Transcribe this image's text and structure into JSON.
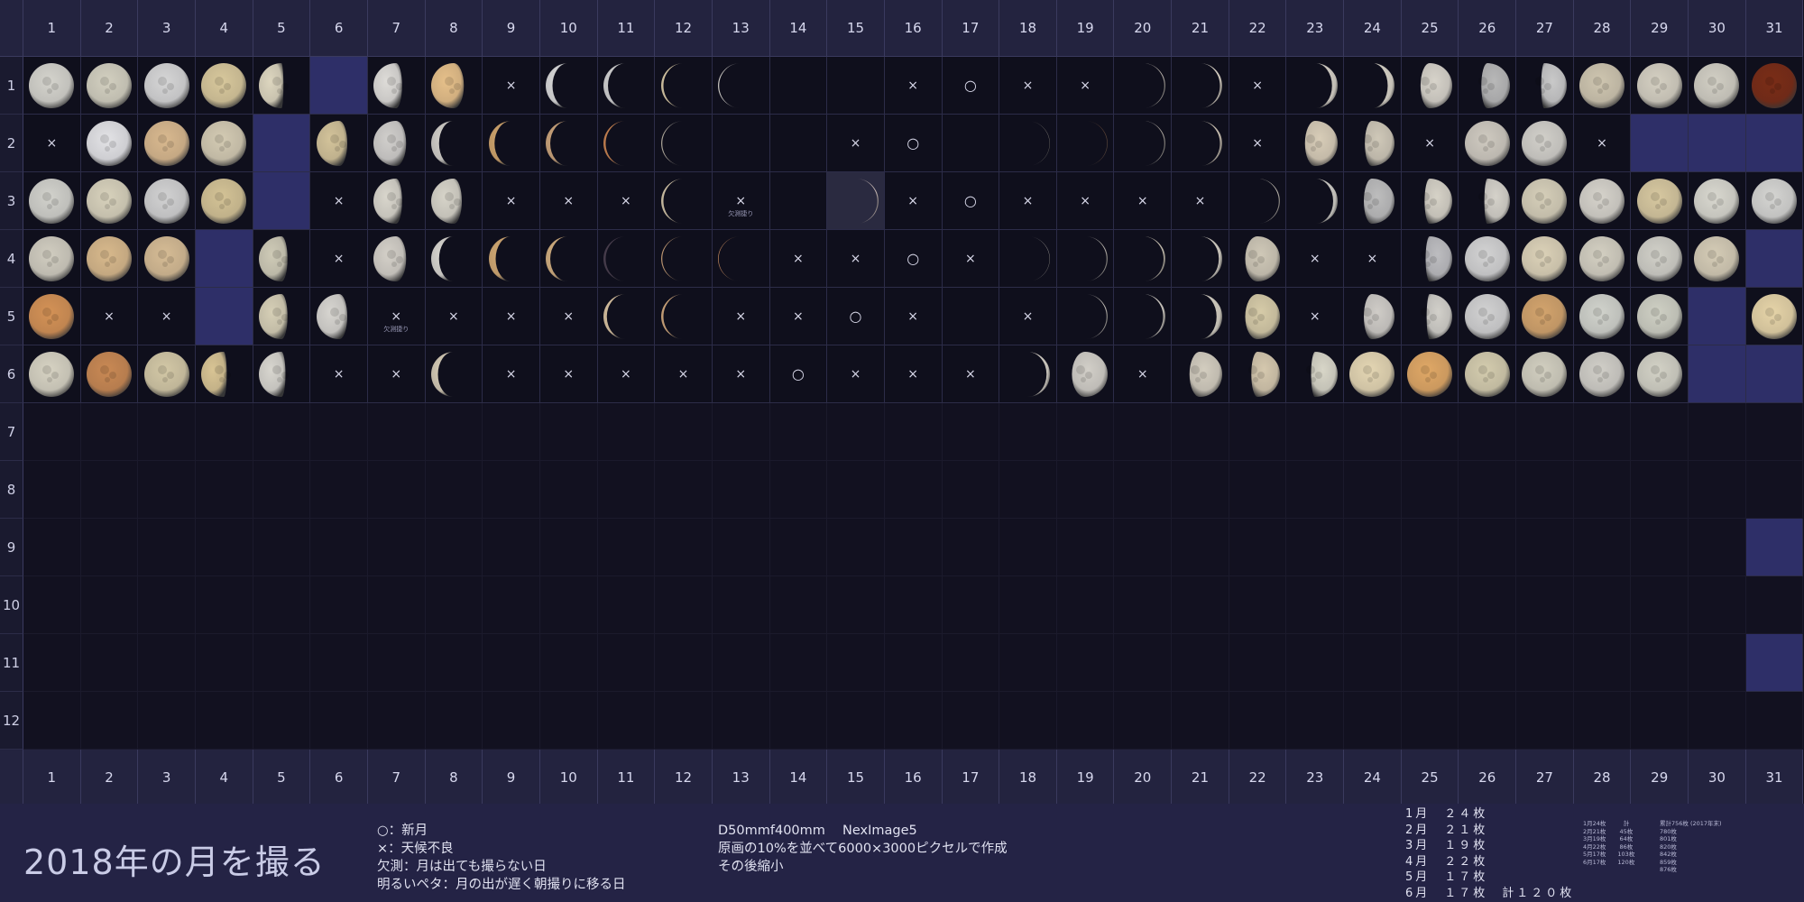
{
  "title": "2018年の月を撮る",
  "days": [
    "1",
    "2",
    "3",
    "4",
    "5",
    "6",
    "7",
    "8",
    "9",
    "10",
    "11",
    "12",
    "13",
    "14",
    "15",
    "16",
    "17",
    "18",
    "19",
    "20",
    "21",
    "22",
    "23",
    "24",
    "25",
    "26",
    "27",
    "28",
    "29",
    "30",
    "31"
  ],
  "months": [
    "1",
    "2",
    "3",
    "4",
    "5",
    "6",
    "7",
    "8",
    "9",
    "10",
    "11",
    "12"
  ],
  "legend": [
    "○：新月",
    "×：天候不良",
    "欠測：月は出ても撮らない日",
    "明るいペタ：月の出が遅く朝撮りに移る日"
  ],
  "tech": [
    "D50mmf400mm　 NexImage5",
    "原画の10%を並べて6000×3000ピクセルで作成",
    "その後縮小"
  ],
  "counts": [
    "1月　２４枚",
    "2月　２１枚",
    "3月　１９枚",
    "4月　２２枚",
    "5月　１７枚",
    "6月　１７枚　計１２０枚"
  ],
  "tiny_left": [
    "1月24枚　　　計",
    "2月21枚　　 45枚",
    "3月19枚　　 64枚",
    "4月22枚　　 86枚",
    "5月17枚　　103枚",
    "6月17枚　　120枚"
  ],
  "tiny_right": [
    "累計756枚 (2017年末)",
    "780枚",
    "801枚",
    "820枚",
    "842枚",
    "859枚",
    "876枚"
  ],
  "grid": [
    [
      "M:f:0:#d5d4cd",
      "M:f:0:#d3d0c0",
      "M:f:0:#d6d6d6",
      "M:f:0:#d8c89c",
      "M:g:-0.9:#ddd6bf",
      "B",
      "M:g:-0.7:#dedcd8",
      "M:g:-0.5:#e6c08a",
      "X",
      "M:c:-0.3:#d8d8d8",
      "M:c:-0.2:#d0d0d0",
      "M:c:-0.1:#d9c9a5",
      "M:c:-0.05:#d9d6cf",
      "M:c:0:#d1a56a",
      "M:c:0:#c47a4b",
      "X",
      "O",
      "X",
      "X",
      "M:c:0.05:#c9c2b8",
      "M:c:0.1:#e0d8ca",
      "X",
      "M:c:0.25:#d4cfc5",
      "M:c:0.3:#d7d2c6",
      "M:g:0.55:#d7d3ca",
      "M:g:0.7:#b8b8b8",
      "M:g:0.85:#c9c9c9",
      "M:f:0:#cfc6b0",
      "M:f:0:#d5d0c2",
      "M:f:0:#d2cfc4",
      "M:f:0:#7a2d17"
    ],
    [
      "X",
      "M:f:0:#e3e3e6",
      "M:f:0:#d9b98f",
      "M:f:0:#d4cbb3",
      "B",
      "M:g:-0.6:#d3c39a",
      "M:g:-0.5:#d1cfcc",
      "M:c:-0.35:#d0cdc7",
      "M:c:-0.25:#cfa46c",
      "M:c:-0.2:#caa37a",
      "M:c:-0.1:#c98350",
      "M:c:-0.05:#b9b1a3",
      "M:c:0:#a6998a",
      "M:c:0:#7a5036",
      "X",
      "O",
      "M:c:0:#3a3636",
      "M:c:0.02:#8f8a80",
      "M:c:0.03:#6e4e3a",
      "M:c:0.05:#b8b2a8",
      "M:c:0.1:#d0c6b6",
      "X",
      "M:g:0.5:#d8cdb8",
      "M:g:0.65:#cfc8b8",
      "X",
      "M:f:0:#cfcac0",
      "M:f:0:#d2d0ca",
      "X",
      "B",
      "B",
      "B"
    ],
    [
      "M:f:0:#d2d2cc",
      "M:f:0:#d8d2bc",
      "M:f:0:#d2d2d2",
      "M:f:0:#d4c396",
      "B",
      "X",
      "M:g:-0.7:#d9d6cc",
      "M:g:-0.6:#d7d4c9",
      "X",
      "X",
      "X",
      "M:c:-0.1:#d1c3a6",
      "XN",
      "M:c:0:#d88b52",
      "L",
      "X",
      "O",
      "X",
      "X",
      "X",
      "X",
      "M:c:0.05:#cfc9bd",
      "M:c:0.2:#cfcdc6",
      "M:g:0.6:#bdbdbd",
      "M:g:0.75:#d6d2c7",
      "M:g:0.85:#d5d2ca",
      "M:f:0:#d6cfb9",
      "M:f:0:#d6d3cb",
      "M:f:0:#d7c8a0",
      "M:f:0:#d9d8cf",
      "M:f:0:#d5d5d2"
    ],
    [
      "M:f:0:#d1cdc0",
      "M:f:0:#d8b98c",
      "M:f:0:#d6bc95",
      "B",
      "M:g:-0.7:#cfcbb7",
      "X",
      "M:g:-0.5:#d4d0c8",
      "M:c:-0.35:#d7d5cf",
      "M:c:-0.3:#d1a872",
      "M:c:-0.2:#d1ae7f",
      "M:c:-0.1:#4a3f4e",
      "M:c:-0.05:#caa077",
      "M:c:-0.03:#c98c5e",
      "X",
      "X",
      "O",
      "X",
      "M:c:0.02:#b9b4ac",
      "M:c:0.05:#c6c1b8",
      "M:c:0.08:#cfc7b6",
      "M:c:0.15:#d4cfc4",
      "M:g:0.4:#cfc8b7",
      "X",
      "X",
      "M:g:0.8:#bdbdc0",
      "M:f:0:#d3d3d3",
      "M:f:0:#dcd2b8",
      "M:f:0:#d4d0c2",
      "M:f:0:#d1d0c8",
      "M:f:0:#d5ccb6",
      "B"
    ],
    [
      "M:f:0:#d49256",
      "X",
      "X",
      "B",
      "M:g:-0.7:#d6cfb6",
      "M:g:-0.6:#d7d5d0",
      "XN",
      "X",
      "X",
      "X",
      "M:c:-0.15:#d8c2a0",
      "M:c:-0.1:#d0a77b",
      "X",
      "X",
      "O",
      "X",
      "M:c:0:#cf7d44",
      "X",
      "M:c:0.05:#d3cec5",
      "M:c:0.1:#d4cfc6",
      "M:c:0.25:#d4cfc2",
      "M:g:0.4:#d6cba8",
      "X",
      "M:g:0.6:#cfccc7",
      "M:g:0.85:#d2d0ca",
      "M:f:0:#d2d2d2",
      "M:f:0:#d3a46d",
      "M:f:0:#d1d3cc",
      "M:f:0:#cfd0c4",
      "B",
      "M:f:0:#e6d4a8"
    ],
    [
      "M:f:0:#d7d3c3",
      "M:f:0:#c98954",
      "M:f:0:#d3c8a6",
      "M:g:-0.85:#d8c494",
      "M:g:-0.8:#d8d6cf",
      "X",
      "X",
      "M:c:-0.3:#d4cab5",
      "X",
      "X",
      "X",
      "X",
      "X",
      "O",
      "X",
      "X",
      "X",
      "M:c:0.15:#d6d1c7",
      "M:g:0.35:#d2cfc8",
      "X",
      "M:g:0.5:#d3cdbf",
      "M:g:0.7:#d5c8ae",
      "M:g:0.8:#d8d6c8",
      "M:f:0:#e4d6b3",
      "M:f:0:#e0a866",
      "M:f:0:#d4ccae",
      "M:f:0:#d2cfc0",
      "M:f:0:#d1cfc8",
      "M:f:0:#d3d2c6",
      "B",
      "B"
    ]
  ],
  "note": "欠測捷り"
}
